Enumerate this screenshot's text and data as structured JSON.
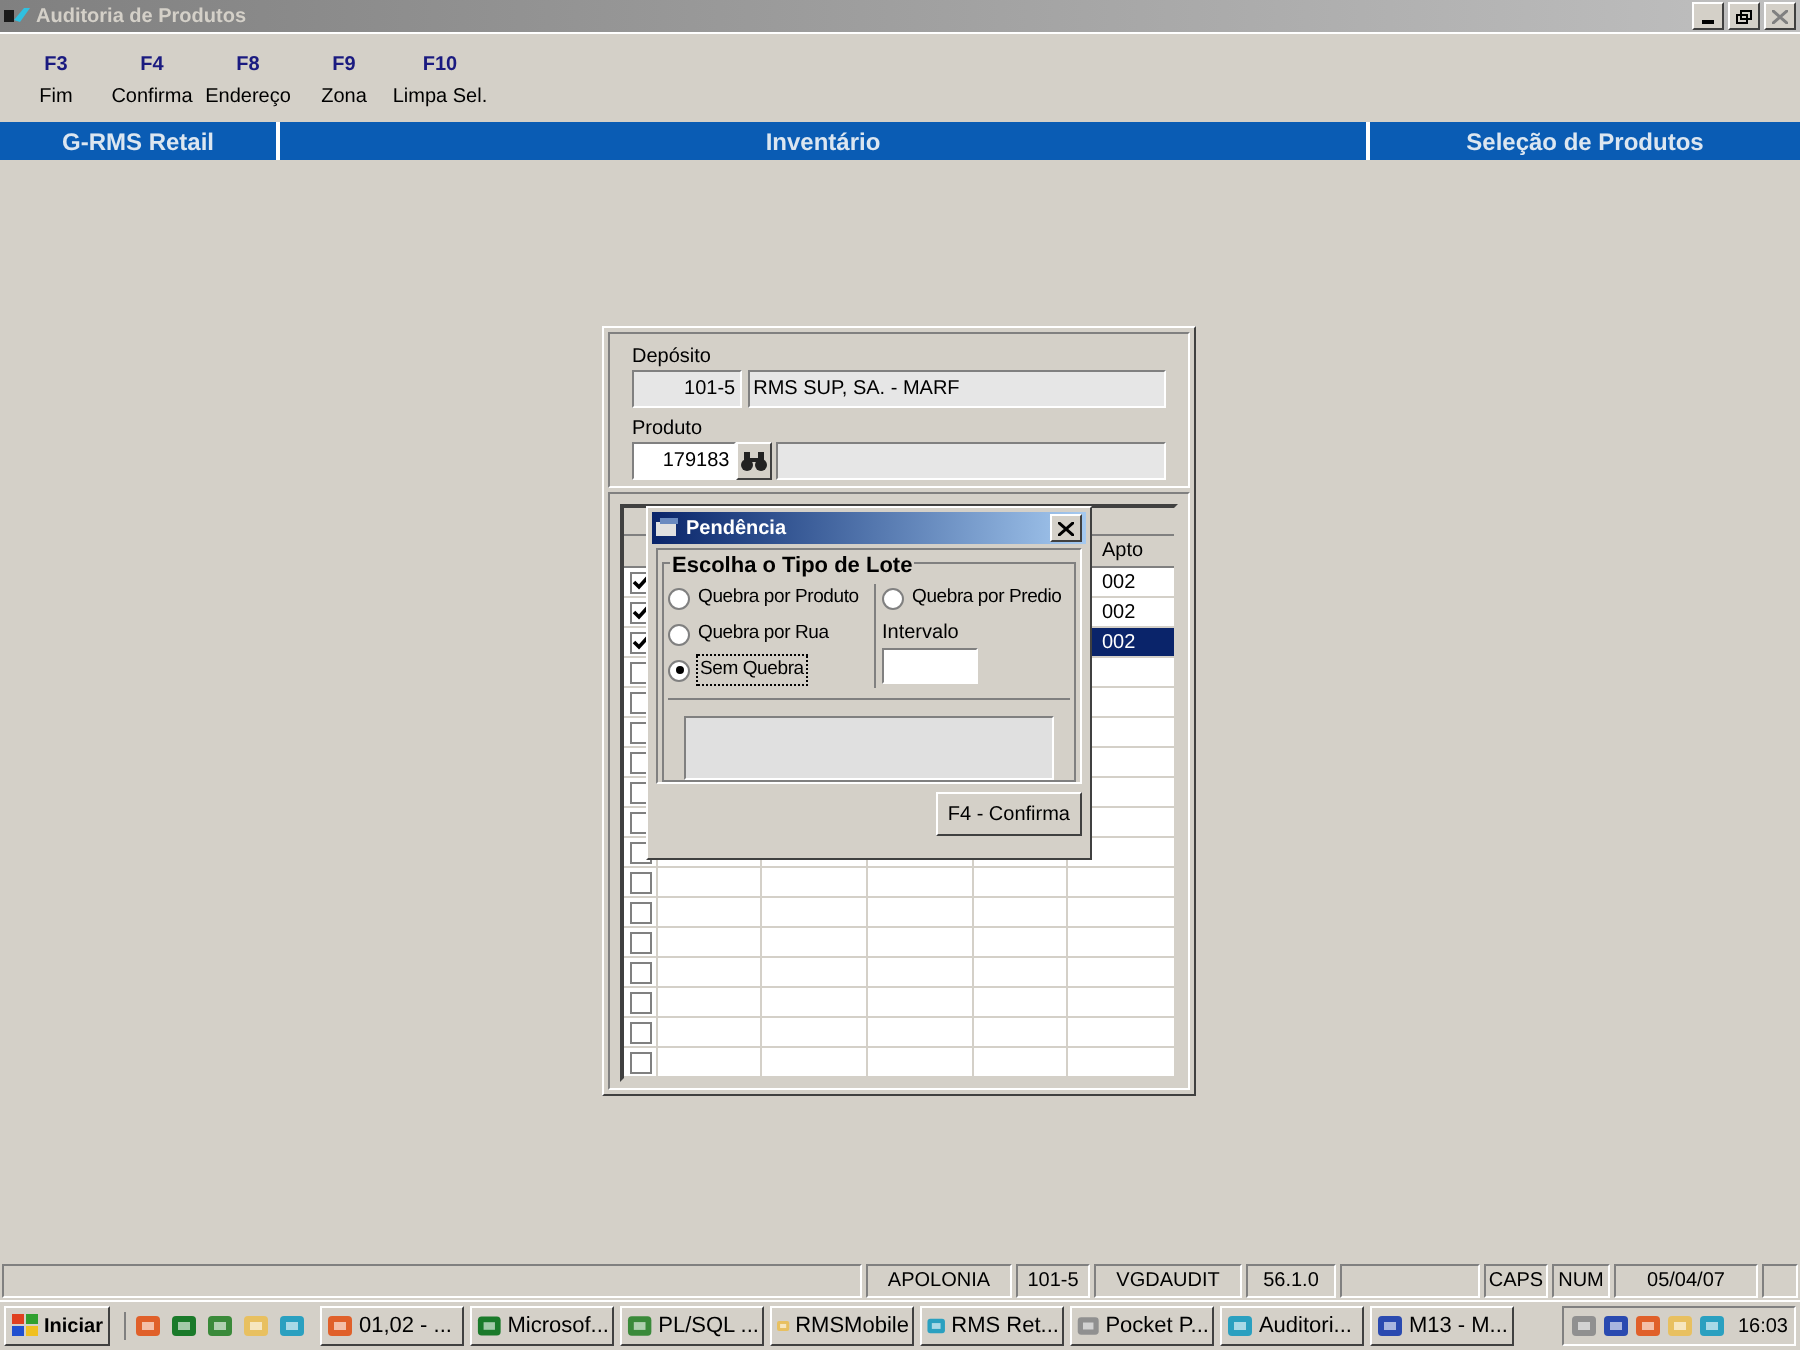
{
  "window": {
    "title": "Auditoria de Produtos"
  },
  "toolbar": [
    {
      "key": "F3",
      "label": "Fim"
    },
    {
      "key": "F4",
      "label": "Confirma"
    },
    {
      "key": "F8",
      "label": "Endereço"
    },
    {
      "key": "F9",
      "label": "Zona"
    },
    {
      "key": "F10",
      "label": "Limpa Sel."
    }
  ],
  "header": [
    "G-RMS Retail",
    "Inventário",
    "Seleção de Produtos"
  ],
  "form": {
    "deposito_label": "Depósito",
    "deposito_code": "101-5",
    "deposito_name": "RMS SUP, SA. - MARF",
    "produto_label": "Produto",
    "produto_code": "179183"
  },
  "grid": {
    "apto_header": "Apto",
    "rows": [
      {
        "checked": true,
        "selected": false,
        "apto": "002"
      },
      {
        "checked": true,
        "selected": false,
        "apto": "002"
      },
      {
        "checked": true,
        "selected": true,
        "apto": "002"
      },
      {
        "checked": false,
        "selected": false
      },
      {
        "checked": false,
        "selected": false
      },
      {
        "checked": false,
        "selected": false
      },
      {
        "checked": false,
        "selected": false
      },
      {
        "checked": false,
        "selected": false
      },
      {
        "checked": false,
        "selected": false
      },
      {
        "checked": false,
        "selected": false
      },
      {
        "checked": false,
        "selected": false
      },
      {
        "checked": false,
        "selected": false
      },
      {
        "checked": false,
        "selected": false
      },
      {
        "checked": false,
        "selected": false
      },
      {
        "checked": false,
        "selected": false
      },
      {
        "checked": false,
        "selected": false
      },
      {
        "checked": false,
        "selected": false
      }
    ]
  },
  "dialog": {
    "title": "Pendência",
    "group_title": "Escolha o Tipo de Lote",
    "options": [
      {
        "label": "Quebra por Produto",
        "selected": false
      },
      {
        "label": "Quebra por Rua",
        "selected": false
      },
      {
        "label": "Sem Quebra",
        "selected": true
      },
      {
        "label": "Quebra por Predio",
        "selected": false
      }
    ],
    "interval_label": "Intervalo",
    "confirm": "F4 - Confirma"
  },
  "status_bar": [
    "APOLONIA",
    "101-5",
    "VGDAUDIT",
    "56.1.0",
    "CAPS",
    "NUM",
    "05/04/07"
  ],
  "taskbar": {
    "start": "Iniciar",
    "tasks": [
      "01,02 - ...",
      "Microsof...",
      "PL/SQL ...",
      "RMSMobile",
      "RMS Ret...",
      "Pocket P...",
      "Auditori...",
      "M13 - M..."
    ],
    "clock": "16:03"
  }
}
